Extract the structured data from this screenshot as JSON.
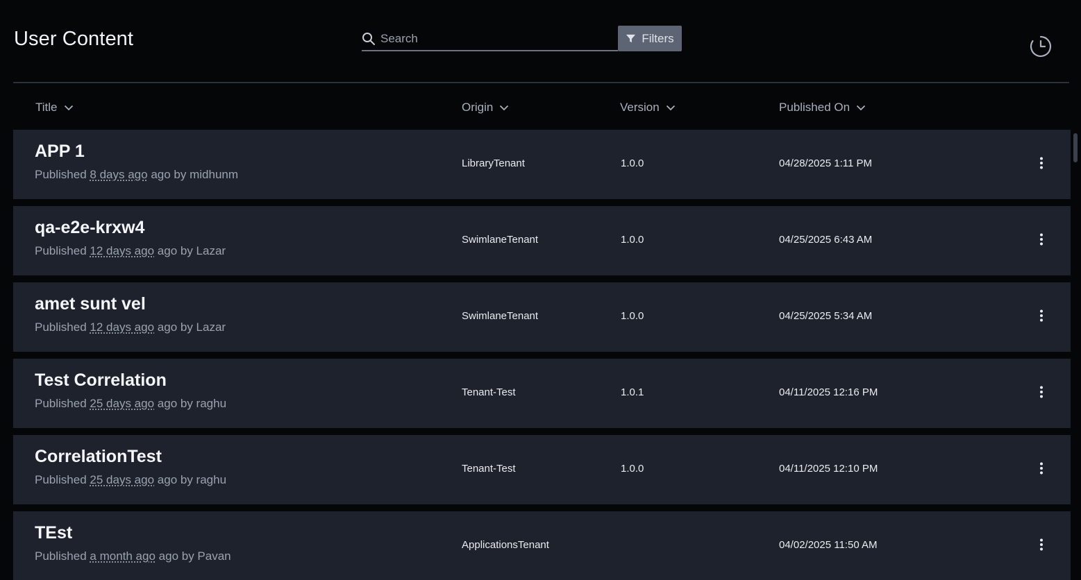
{
  "header": {
    "title": "User Content",
    "search_placeholder": "Search",
    "filters_label": "Filters"
  },
  "columns": {
    "title": "Title",
    "origin": "Origin",
    "version": "Version",
    "published_on": "Published On"
  },
  "rows": [
    {
      "title": "APP 1",
      "published_prefix": "Published",
      "published_rel": "8 days ago",
      "published_suffix": "ago by midhunm",
      "origin": "LibraryTenant",
      "version": "1.0.0",
      "published_on": "04/28/2025 1:11 PM"
    },
    {
      "title": "qa-e2e-krxw4",
      "published_prefix": "Published",
      "published_rel": "12 days ago",
      "published_suffix": "ago by Lazar",
      "origin": "SwimlaneTenant",
      "version": "1.0.0",
      "published_on": "04/25/2025 6:43 AM"
    },
    {
      "title": "amet sunt vel",
      "published_prefix": "Published",
      "published_rel": "12 days ago",
      "published_suffix": "ago by Lazar",
      "origin": "SwimlaneTenant",
      "version": "1.0.0",
      "published_on": "04/25/2025 5:34 AM"
    },
    {
      "title": "Test Correlation",
      "published_prefix": "Published",
      "published_rel": "25 days ago",
      "published_suffix": "ago by raghu",
      "origin": "Tenant-Test",
      "version": "1.0.1",
      "published_on": "04/11/2025 12:16 PM"
    },
    {
      "title": "CorrelationTest",
      "published_prefix": "Published",
      "published_rel": "25 days ago",
      "published_suffix": "ago by raghu",
      "origin": "Tenant-Test",
      "version": "1.0.0",
      "published_on": "04/11/2025 12:10 PM"
    },
    {
      "title": "TEst",
      "published_prefix": "Published",
      "published_rel": "a month ago",
      "published_suffix": "ago by Pavan",
      "origin": "ApplicationsTenant",
      "version": "",
      "published_on": "04/02/2025 11:50 AM"
    }
  ],
  "icons": {
    "search": "search-icon",
    "filter": "filter-icon",
    "history": "history-clock-icon",
    "sort": "chevron-down-icon",
    "row_menu": "more-vertical-icon"
  },
  "colors": {
    "background": "#050607",
    "row_background": "#1e222c",
    "filters_button": "#5d6575",
    "muted_text": "#9ba2ae"
  }
}
